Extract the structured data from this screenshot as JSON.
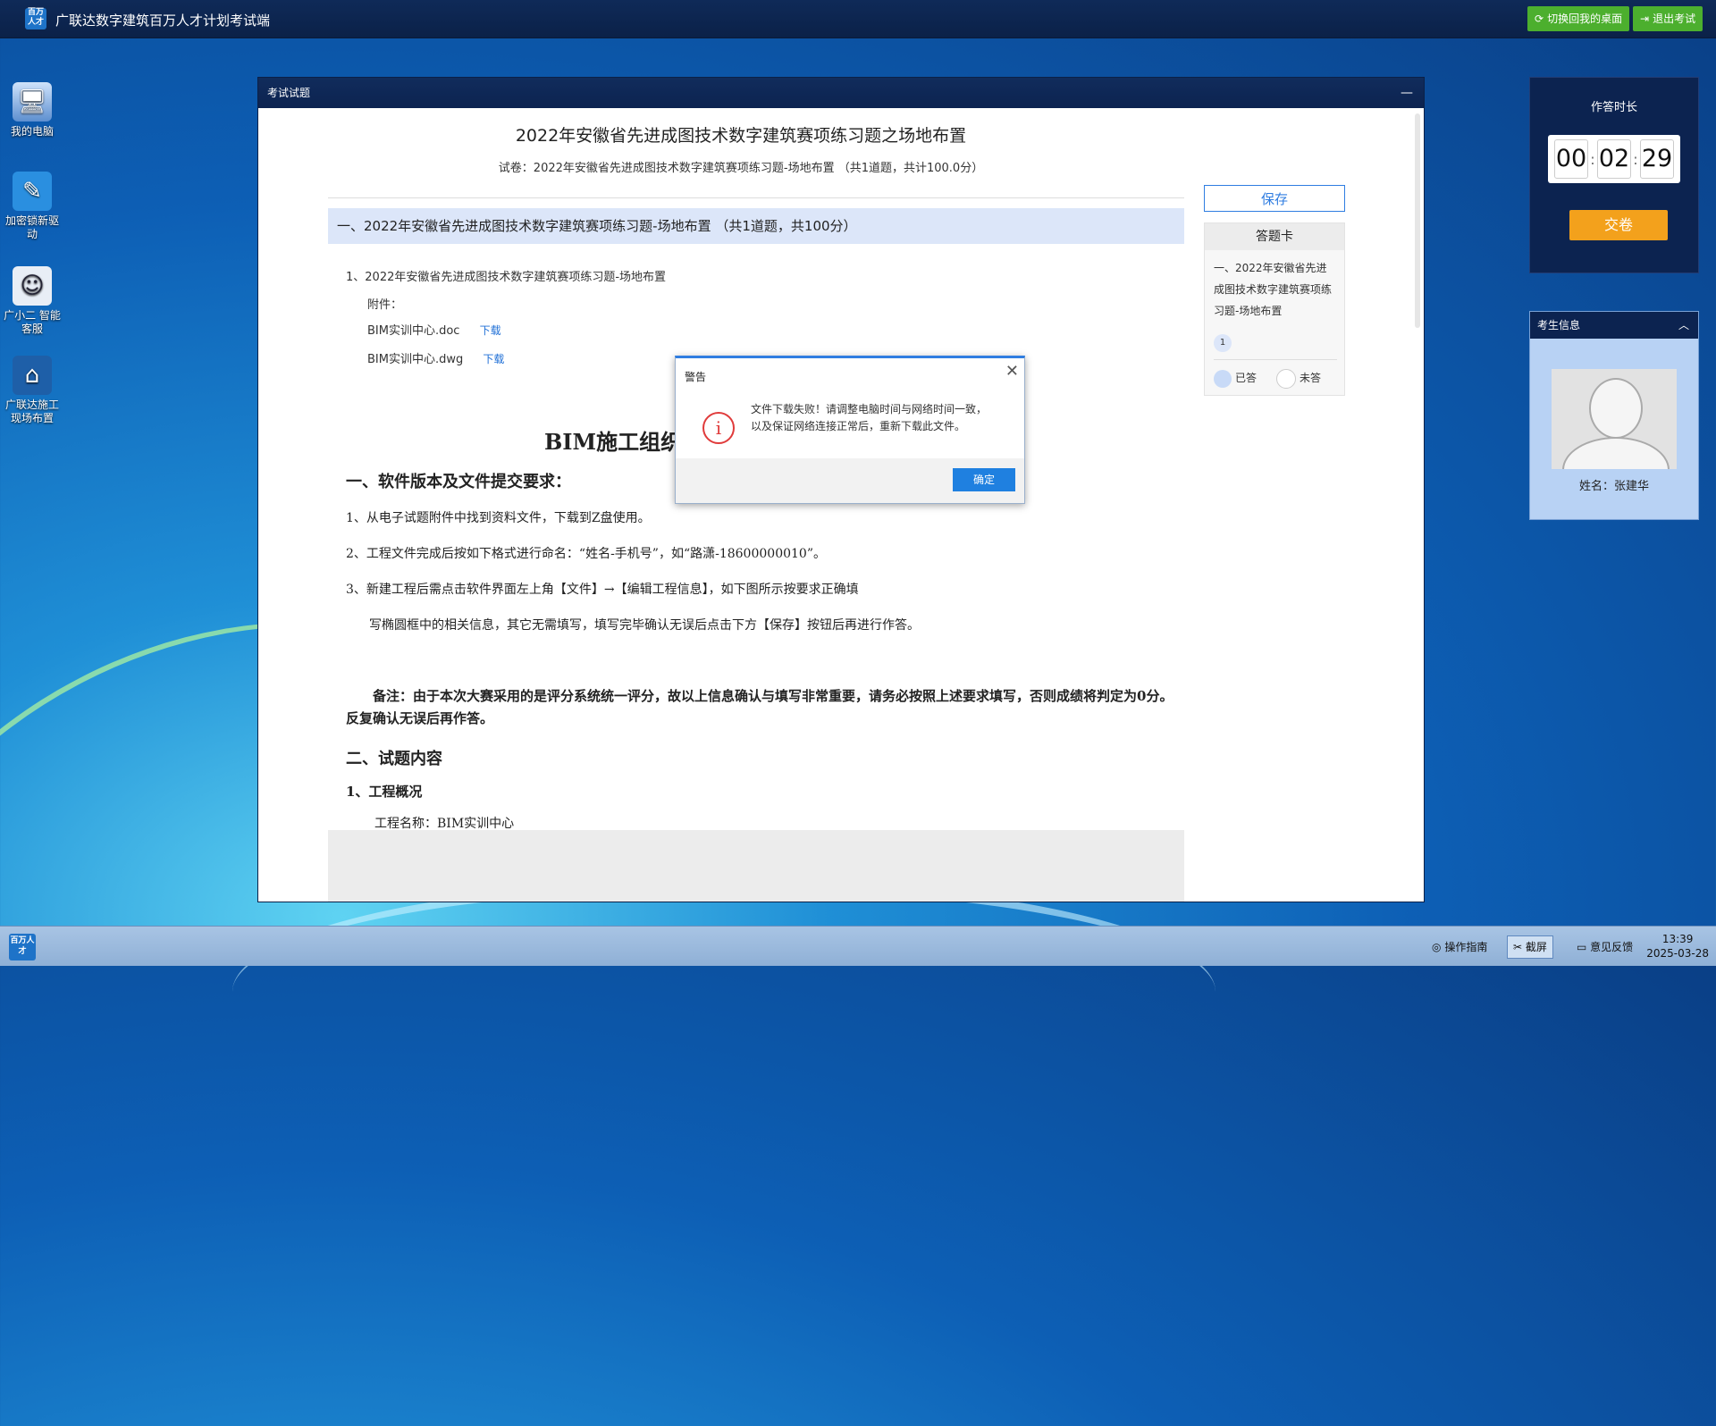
{
  "app": {
    "title": "广联达数字建筑百万人才计划考试端",
    "logo_text": "百万人才",
    "btn_switch": "切换回我的桌面",
    "btn_exit": "退出考试"
  },
  "desktop": [
    {
      "label": "我的电脑",
      "icon": "computer-icon"
    },
    {
      "label": "加密锁新驱动",
      "icon": "dongle-driver-icon"
    },
    {
      "label": "广小二 智能客服",
      "icon": "robot-icon"
    },
    {
      "label": "广联达施工 现场布置",
      "icon": "construction-icon"
    }
  ],
  "window": {
    "title": "考试试题",
    "minimize": "—",
    "paper_title": "2022年安徽省先进成图技术数字建筑赛项练习题之场地布置",
    "paper_sub": "试卷：2022年安徽省先进成图技术数字建筑赛项练习题-场地布置 （共1道题，共计100.0分）",
    "section": "一、2022年安徽省先进成图技术数字建筑赛项练习题-场地布置 （共1道题，共100分）",
    "question": "1、2022年安徽省先进成图技术数字建筑赛项练习题-场地布置",
    "attach_label": "附件：",
    "files": [
      {
        "name": "BIM实训中心.doc",
        "link": "下载"
      },
      {
        "name": "BIM实训中心.dwg",
        "link": "下载"
      }
    ],
    "doc_title": "BIM施工组织",
    "h_software": "一、软件版本及文件提交要求：",
    "p1": "1、从电子试题附件中找到资料文件，下载到Z盘使用。",
    "p2": "2、工程文件完成后按如下格式进行命名：“姓名-手机号”，如“路潇-18600000010”。",
    "p3": "3、新建工程后需点击软件界面左上角【文件】→【编辑工程信息】，如下图所示按要求正确填",
    "p4": "写椭圆框中的相关信息，其它无需填写，填写完毕确认无误后点击下方【保存】按钮后再进行作答。",
    "note": "备注：由于本次大赛采用的是评分系统统一评分，故以上信息确认与填写非常重要，请务必按照上述要求填写，否则成绩将判定为0分。反复确认无误后再作答。",
    "h_content": "二、试题内容",
    "h_overview": "1、工程概况",
    "p_name": "工程名称：BIM实训中心",
    "save": "保存",
    "card_title": "答题卡",
    "card_section": "一、2022年安徽省先进成图技术数字建筑赛项练习题-场地布置",
    "card_num": "1",
    "legend_done": "已答",
    "legend_todo": "未答"
  },
  "timer": {
    "title": "作答时长",
    "hh": "00",
    "mm": "02",
    "ss": "29",
    "submit": "交卷"
  },
  "candidate": {
    "title": "考生信息",
    "name": "姓名：张建华"
  },
  "dialog": {
    "title": "警告",
    "message": "文件下载失败！请调整电脑时间与网络时间一致，以及保证网络连接正常后，重新下载此文件。",
    "ok": "确定"
  },
  "taskbar": {
    "guide": "操作指南",
    "screenshot": "截屏",
    "feedback": "意见反馈",
    "time": "13:39",
    "date": "2025-03-28"
  },
  "colors": {
    "accent": "#2f7de1",
    "submit": "#f3a11c",
    "green": "#4caf2e",
    "error": "#e03b3b"
  }
}
